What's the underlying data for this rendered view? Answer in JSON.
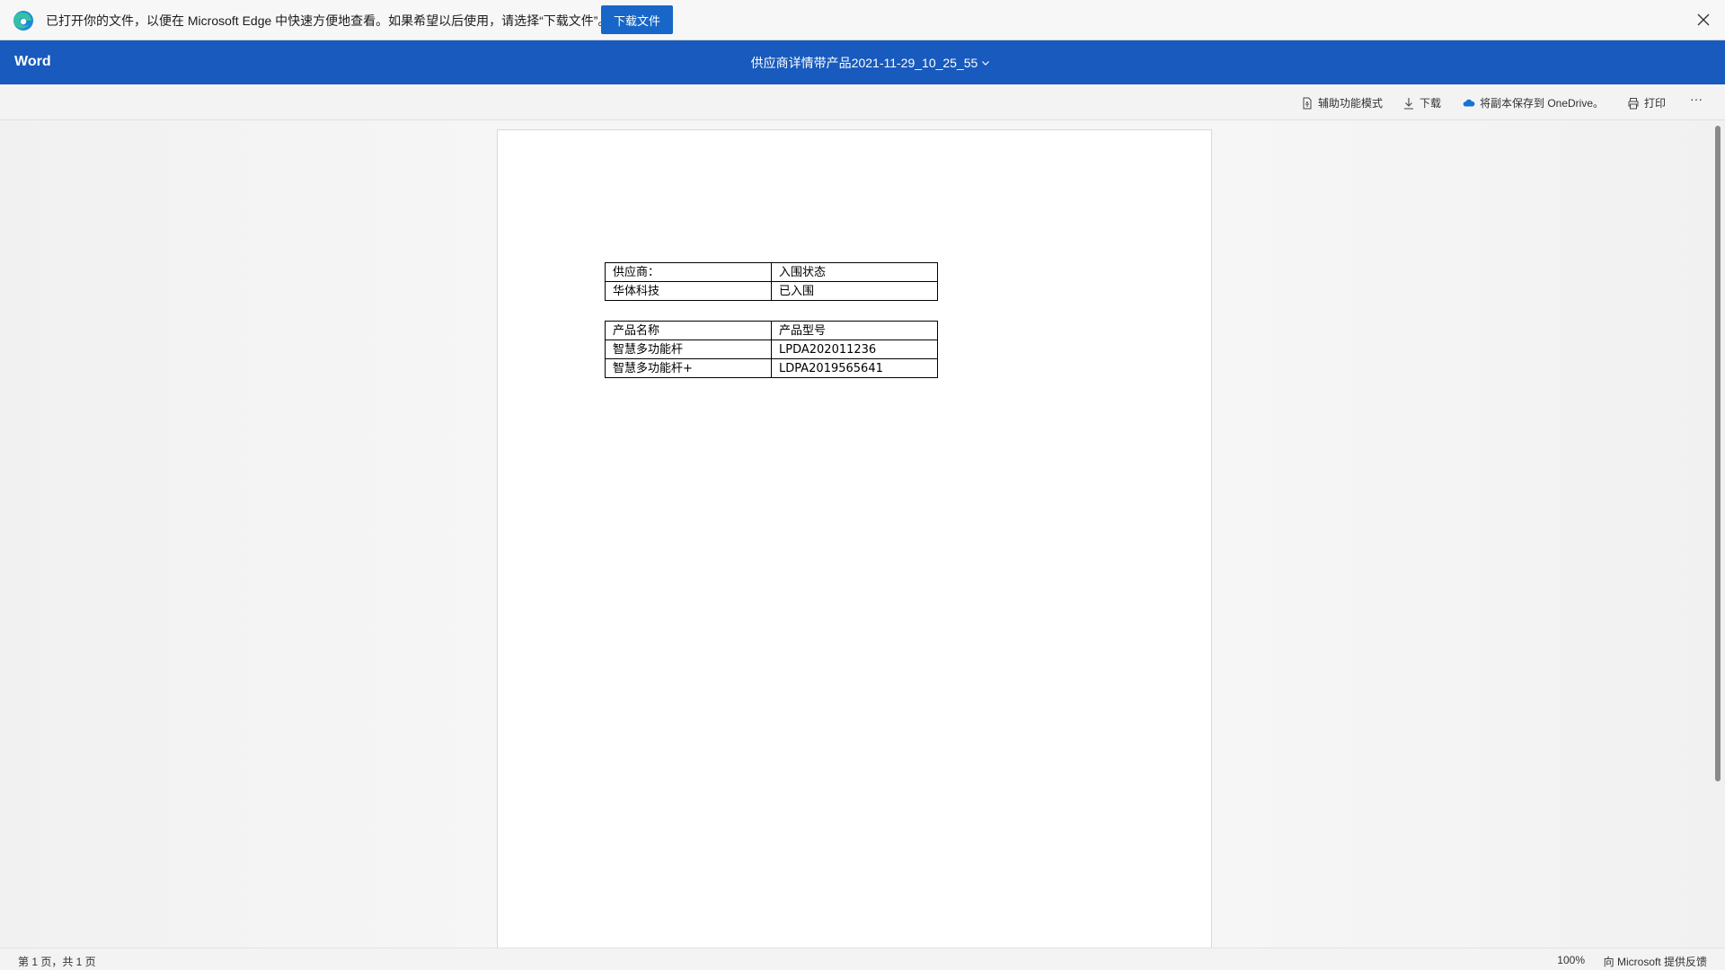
{
  "edge_bar": {
    "message": "已打开你的文件，以便在 Microsoft Edge 中快速方便地查看。如果希望以后使用，请选择“下载文件”。",
    "download_button": "下载文件"
  },
  "header": {
    "app_name": "Word",
    "doc_title": "供应商详情带产品2021-11-29_10_25_55"
  },
  "toolbar": {
    "accessibility": "辅助功能模式",
    "download": "下载",
    "save_to_onedrive": "将副本保存到 OneDrive。",
    "print": "打印",
    "more": "···"
  },
  "document": {
    "table1": [
      [
        "供应商：",
        "入围状态"
      ],
      [
        "华体科技",
        "已入围"
      ]
    ],
    "table2": [
      [
        "产品名称",
        "产品型号"
      ],
      [
        "智慧多功能杆",
        "LPDA202011236"
      ],
      [
        "智慧多功能杆+",
        "LDPA2019565641"
      ]
    ]
  },
  "status": {
    "page_info": "第 1 页，共 1 页",
    "zoom": "100%",
    "feedback": "向 Microsoft 提供反馈"
  },
  "colors": {
    "word_blue": "#185abd",
    "edge_button": "#1766c8"
  }
}
